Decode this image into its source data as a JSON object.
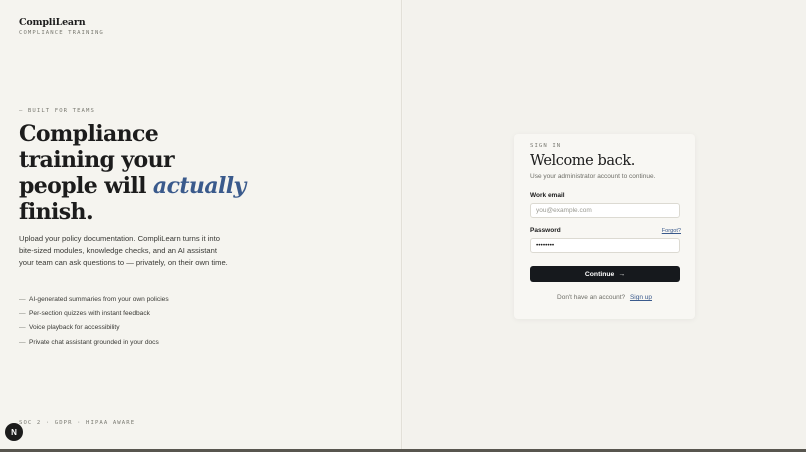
{
  "brand": {
    "name": "CompliLearn",
    "tagline": "COMPLIANCE TRAINING"
  },
  "hero": {
    "eyebrow": "— BUILT FOR TEAMS",
    "headline_line1": "Compliance",
    "headline_line2": "training your",
    "headline_line3_pre": "people will ",
    "headline_line3_accent": "actually",
    "headline_line4": "finish.",
    "lead": "Upload your policy documentation. CompliLearn turns it into bite-sized modules, knowledge checks, and an AI assistant your team can ask questions to — privately, on their own time.",
    "features": [
      {
        "dash": "—",
        "text": "AI-generated summaries from your own policies"
      },
      {
        "dash": "—",
        "text": "Per-section quizzes with instant feedback"
      },
      {
        "dash": "—",
        "text": "Voice playback for accessibility"
      },
      {
        "dash": "—",
        "text": "Private chat assistant grounded in your docs"
      }
    ],
    "footer_note": "SOC 2 · GDPR · HIPAA AWARE"
  },
  "badge": {
    "letter": "N"
  },
  "signin": {
    "eyebrow": "SIGN IN",
    "title": "Welcome back.",
    "subtitle": "Use your administrator account to continue.",
    "email_label": "Work email",
    "email_placeholder": "you@example.com",
    "email_value": "",
    "password_label": "Password",
    "password_value": "••••••••",
    "forgot_label": "Forgot?",
    "continue_label": "Continue",
    "continue_icon": "→",
    "no_account_text": "Don't have an account?",
    "signup_label": "Sign up"
  },
  "colors": {
    "background": "#f5f4ef",
    "accent": "#3a5a8c",
    "button": "#16191d"
  },
  "icons": {
    "continue": "arrow-right-icon",
    "badge": "next-logo-icon"
  }
}
